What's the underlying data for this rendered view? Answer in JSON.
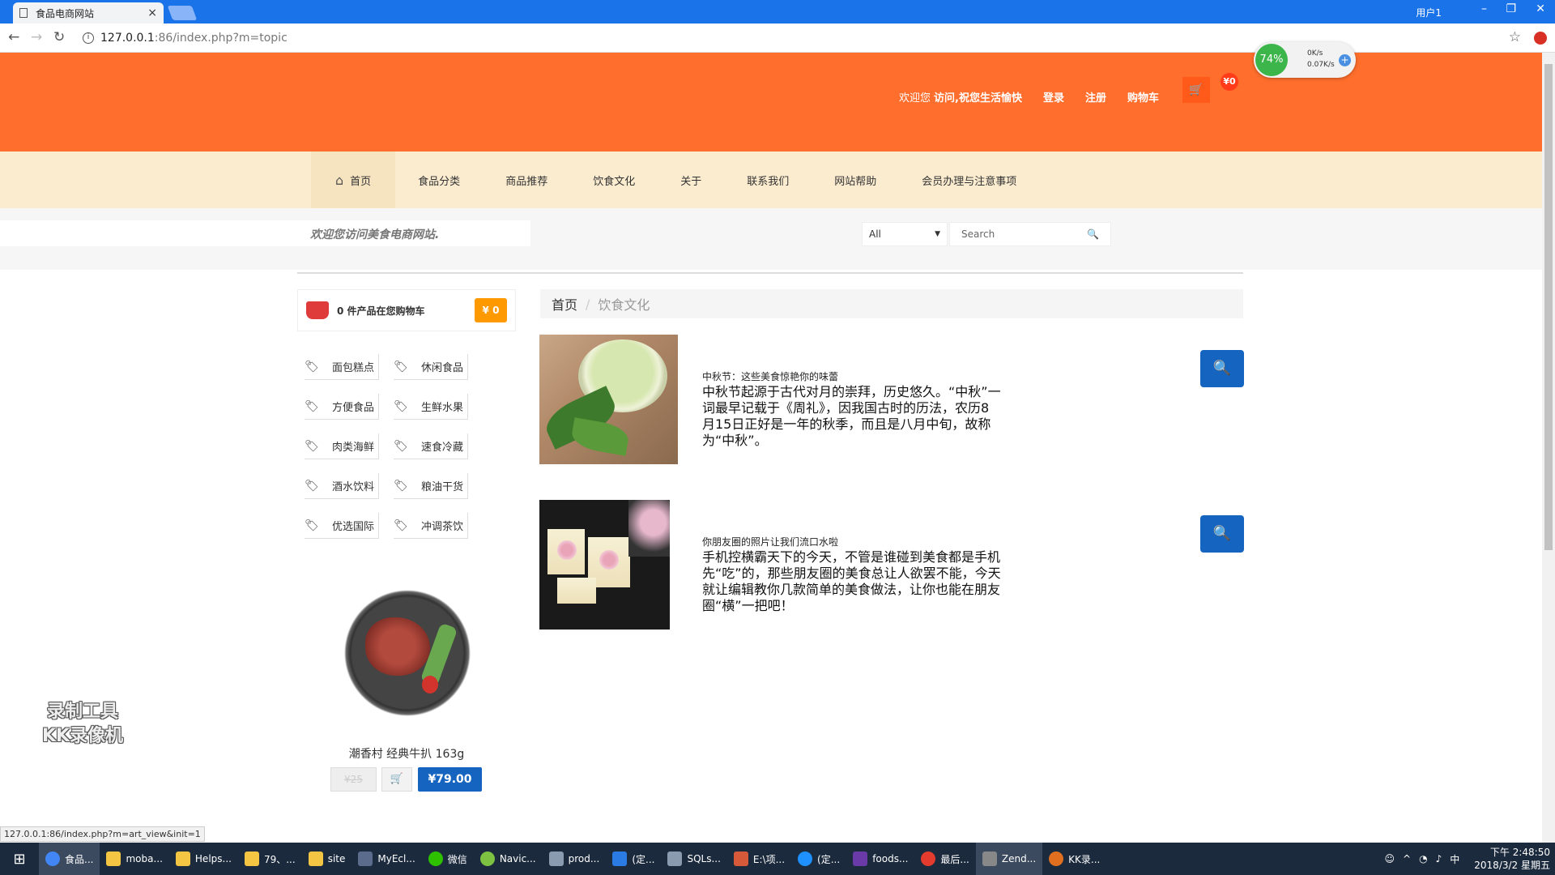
{
  "browser": {
    "tab_title": "食品电商网站",
    "url_host": "127.0.0.1",
    "url_path": ":86/index.php?m=topic",
    "user": "用户1"
  },
  "speed_widget": {
    "percent": "74%",
    "up": "0K/s",
    "down": "0.07K/s"
  },
  "header": {
    "welcome": "欢迎您",
    "greeting": "访问,祝您生活愉快",
    "login": "登录",
    "register": "注册",
    "cart": "购物车",
    "cart_total": "¥0"
  },
  "nav": {
    "items": [
      "首页",
      "食品分类",
      "商品推荐",
      "饮食文化",
      "关于",
      "联系我们",
      "网站帮助",
      "会员办理与注意事项"
    ]
  },
  "search": {
    "welcome_text": "欢迎您访问美食电商网站.",
    "category": "All",
    "placeholder": "Search"
  },
  "sidebar": {
    "cart_summary": "0 件产品在您购物车",
    "cart_badge": "¥ 0",
    "categories": [
      "面包糕点",
      "休闲食品",
      "方便食品",
      "生鲜水果",
      "肉类海鲜",
      "速食冷藏",
      "酒水饮料",
      "粮油干货",
      "优选国际",
      "冲调茶饮"
    ],
    "product": {
      "name": "潮香村 经典牛扒 163g",
      "old_price": "¥25",
      "price": "¥79.00"
    }
  },
  "breadcrumb": {
    "home": "首页",
    "separator": "/",
    "current": "饮食文化"
  },
  "articles": [
    {
      "title": "中秋节：这些美食惊艳你的味蕾",
      "body": "中秋节起源于古代对月的崇拜，历史悠久。“中秋”一词最早记载于《周礼》，因我国古时的历法，农历8月15日正好是一年的秋季，而且是八月中旬，故称为“中秋”。"
    },
    {
      "title": "你朋友圈的照片让我们流口水啦",
      "body": "手机控横霸天下的今天，不管是谁碰到美食都是手机先“吃”的，那些朋友圈的美食总让人欲罢不能，今天就让编辑教你几款简单的美食做法，让你也能在朋友圈“横”一把吧！"
    }
  ],
  "status_url": "127.0.0.1:86/index.php?m=art_view&init=1",
  "watermark": [
    "录制工具",
    "KK录像机"
  ],
  "taskbar": {
    "items": [
      "食品...",
      "moba...",
      "Helps...",
      "79、...",
      "site",
      "MyEcl...",
      "微信",
      "Navic...",
      "prod...",
      "(定...",
      "SQLs...",
      "E:\\项...",
      "(定...",
      "foods...",
      "最后...",
      "Zend...",
      "KK录..."
    ],
    "time": "下午 2:48:50",
    "date": "2018/3/2 星期五",
    "ime": "中"
  },
  "colors": {
    "header_orange": "#ff6e2c",
    "menu_beige": "#fbecd0",
    "accent_blue": "#1565c0",
    "badge_orange": "#ff9900"
  }
}
